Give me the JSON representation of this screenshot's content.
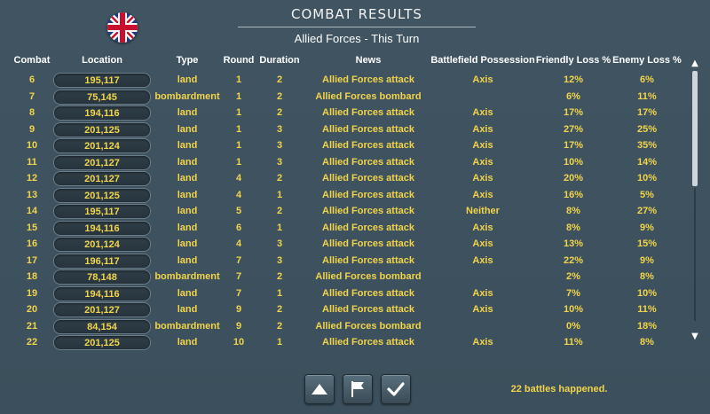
{
  "header": {
    "title": "COMBAT RESULTS",
    "subtitle": "Allied Forces - This Turn",
    "flag_icon": "uk-flag-icon"
  },
  "columns": [
    "Combat",
    "Location",
    "Type",
    "Round",
    "Duration",
    "News",
    "Battlefield Possession",
    "Friendly Loss %",
    "Enemy Loss %"
  ],
  "rows": [
    {
      "combat": "6",
      "location": "195,117",
      "type": "land",
      "round": "1",
      "duration": "2",
      "news": "Allied Forces attack",
      "possession": "Axis",
      "friendly": "12%",
      "enemy": "6%"
    },
    {
      "combat": "7",
      "location": "75,145",
      "type": "bombardment",
      "round": "1",
      "duration": "2",
      "news": "Allied Forces bombard",
      "possession": "",
      "friendly": "6%",
      "enemy": "11%"
    },
    {
      "combat": "8",
      "location": "194,116",
      "type": "land",
      "round": "1",
      "duration": "2",
      "news": "Allied Forces attack",
      "possession": "Axis",
      "friendly": "17%",
      "enemy": "17%"
    },
    {
      "combat": "9",
      "location": "201,125",
      "type": "land",
      "round": "1",
      "duration": "3",
      "news": "Allied Forces attack",
      "possession": "Axis",
      "friendly": "27%",
      "enemy": "25%"
    },
    {
      "combat": "10",
      "location": "201,124",
      "type": "land",
      "round": "1",
      "duration": "3",
      "news": "Allied Forces attack",
      "possession": "Axis",
      "friendly": "17%",
      "enemy": "35%"
    },
    {
      "combat": "11",
      "location": "201,127",
      "type": "land",
      "round": "1",
      "duration": "3",
      "news": "Allied Forces attack",
      "possession": "Axis",
      "friendly": "10%",
      "enemy": "14%"
    },
    {
      "combat": "12",
      "location": "201,127",
      "type": "land",
      "round": "4",
      "duration": "2",
      "news": "Allied Forces attack",
      "possession": "Axis",
      "friendly": "20%",
      "enemy": "10%"
    },
    {
      "combat": "13",
      "location": "201,125",
      "type": "land",
      "round": "4",
      "duration": "1",
      "news": "Allied Forces attack",
      "possession": "Axis",
      "friendly": "16%",
      "enemy": "5%"
    },
    {
      "combat": "14",
      "location": "195,117",
      "type": "land",
      "round": "5",
      "duration": "2",
      "news": "Allied Forces attack",
      "possession": "Neither",
      "friendly": "8%",
      "enemy": "27%"
    },
    {
      "combat": "15",
      "location": "194,116",
      "type": "land",
      "round": "6",
      "duration": "1",
      "news": "Allied Forces attack",
      "possession": "Axis",
      "friendly": "8%",
      "enemy": "9%"
    },
    {
      "combat": "16",
      "location": "201,124",
      "type": "land",
      "round": "4",
      "duration": "3",
      "news": "Allied Forces attack",
      "possession": "Axis",
      "friendly": "13%",
      "enemy": "15%"
    },
    {
      "combat": "17",
      "location": "196,117",
      "type": "land",
      "round": "7",
      "duration": "3",
      "news": "Allied Forces attack",
      "possession": "Axis",
      "friendly": "22%",
      "enemy": "9%"
    },
    {
      "combat": "18",
      "location": "78,148",
      "type": "bombardment",
      "round": "7",
      "duration": "2",
      "news": "Allied Forces bombard",
      "possession": "",
      "friendly": "2%",
      "enemy": "8%"
    },
    {
      "combat": "19",
      "location": "194,116",
      "type": "land",
      "round": "7",
      "duration": "1",
      "news": "Allied Forces attack",
      "possession": "Axis",
      "friendly": "7%",
      "enemy": "10%"
    },
    {
      "combat": "20",
      "location": "201,127",
      "type": "land",
      "round": "9",
      "duration": "2",
      "news": "Allied Forces attack",
      "possession": "Axis",
      "friendly": "10%",
      "enemy": "11%"
    },
    {
      "combat": "21",
      "location": "84,154",
      "type": "bombardment",
      "round": "9",
      "duration": "2",
      "news": "Allied Forces bombard",
      "possession": "",
      "friendly": "0%",
      "enemy": "18%"
    },
    {
      "combat": "22",
      "location": "201,125",
      "type": "land",
      "round": "10",
      "duration": "1",
      "news": "Allied Forces attack",
      "possession": "Axis",
      "friendly": "11%",
      "enemy": "8%"
    }
  ],
  "footer": {
    "status": "22 battles happened.",
    "buttons": [
      {
        "icon": "triangle-up-icon"
      },
      {
        "icon": "flag-icon"
      },
      {
        "icon": "checkmark-icon"
      }
    ]
  },
  "colors": {
    "background": "#3f5260",
    "cell_text": "#f1d44a",
    "header_text": "#ffffff"
  }
}
